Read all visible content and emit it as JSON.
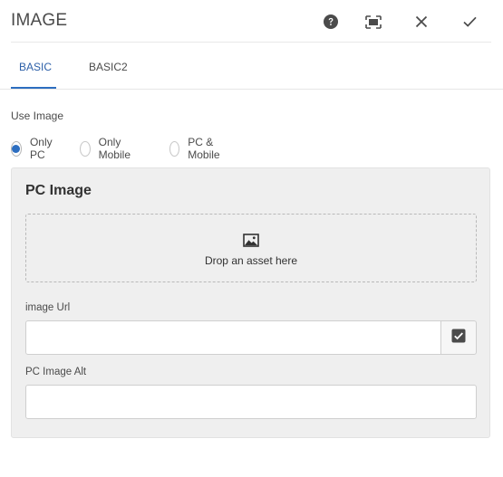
{
  "dialog": {
    "title": "IMAGE",
    "actions": {
      "help_icon": "help-icon",
      "fullscreen_icon": "fullscreen-icon",
      "close_icon": "close-icon",
      "confirm_icon": "check-icon"
    }
  },
  "tabs": [
    {
      "label": "BASIC",
      "active": true
    },
    {
      "label": "BASIC2",
      "active": false
    }
  ],
  "use_image": {
    "label": "Use Image",
    "options": [
      {
        "label": "Only PC",
        "checked": true
      },
      {
        "label": "Only Mobile",
        "checked": false
      },
      {
        "label": "PC & Mobile",
        "checked": false
      }
    ]
  },
  "pc_image": {
    "title": "PC Image",
    "dropzone_text": "Drop an asset here",
    "dropzone_icon": "image-icon",
    "image_url": {
      "label": "image Url",
      "value": "",
      "picker_icon": "checkbox-icon"
    },
    "image_alt": {
      "label": "PC Image Alt",
      "value": ""
    }
  },
  "colors": {
    "accent": "#2d6ec0",
    "panel_background": "#efefef"
  }
}
